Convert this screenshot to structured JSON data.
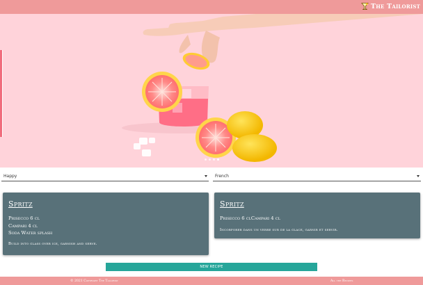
{
  "header": {
    "brand": "The Tailorist",
    "brand_icon": "cocktail-glass-icon",
    "bar_color": "#ef9a9a"
  },
  "carousel": {
    "slides": 4,
    "active_slide": 4
  },
  "filters": {
    "mood": "Happy",
    "language": "French"
  },
  "cards": [
    {
      "title": "Spritz",
      "ingredients": [
        "Prisecco 6 cl",
        "Campari 4 cl",
        "Soda Water splash"
      ],
      "instructions": "Build into glass over ice, garnish and serve."
    },
    {
      "title": "Spritz",
      "ingredients_inline": "Prisecco 6 clCampari 4 cl",
      "instructions": "Incorporer dans un verre sur de la glace, garnir et servir."
    }
  ],
  "actions": {
    "new_button": "New Recipe"
  },
  "footer": {
    "copyright": "© 2021 Copyright The Tailorist",
    "link": "All the Recipes"
  },
  "colors": {
    "card": "#587179",
    "accent": "#26a69a",
    "hero_bg": "#ffd3da"
  }
}
